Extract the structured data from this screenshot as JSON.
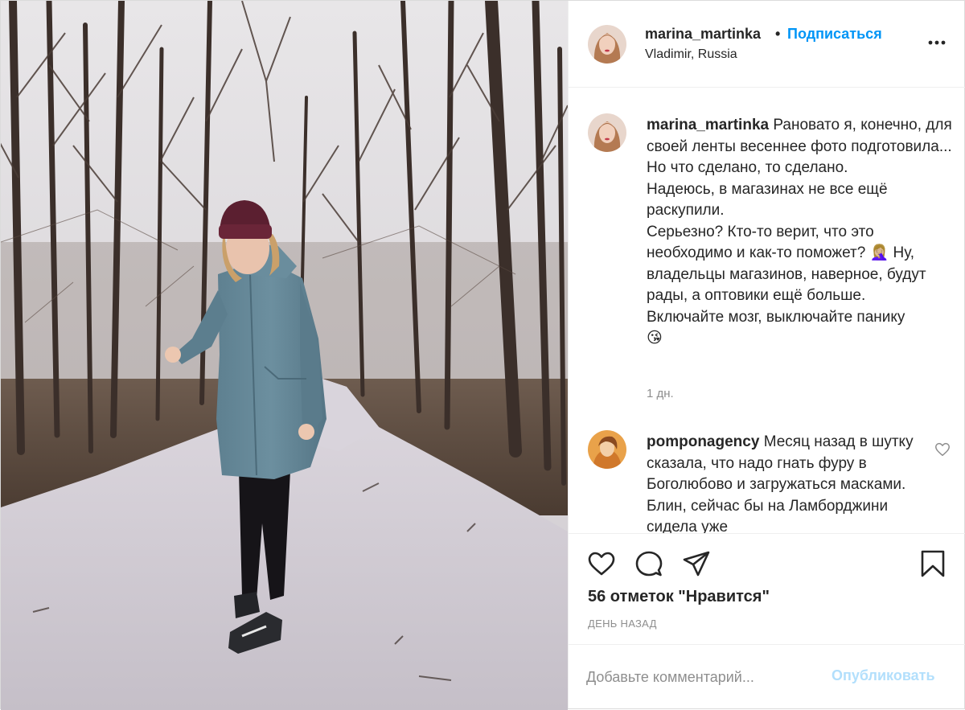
{
  "header": {
    "username": "marina_martinka",
    "separator": "•",
    "follow_label": "Подписаться",
    "location": "Vladimir, Russia",
    "more_icon": "more-horizontal-icon"
  },
  "caption": {
    "username": "marina_martinka",
    "text": "Рановато я, конечно, для своей ленты весеннее фото подготовила...\nНо что сделано, то сделано.\nНадеюсь, в магазинах не все ещё раскупили.\nСерьезно? Кто-то верит, что это необходимо и как-то поможет? 🤦🏼‍♀️ Ну, владельцы магазинов, наверное, будут рады, а оптовики ещё больше.\nВключайте мозг, выключайте панику\n😘",
    "time": "1 дн."
  },
  "comments": [
    {
      "username": "pomponagency",
      "text": "Месяц назад в шутку сказала, что надо гнать фуру в Боголюбово и загружаться масками. Блин, сейчас бы на Ламборджини сидела уже"
    }
  ],
  "actions": {
    "like_icon": "heart-icon",
    "comment_icon": "comment-icon",
    "share_icon": "paper-plane-icon",
    "save_icon": "bookmark-icon"
  },
  "likes_text": "56 отметок \"Нравится\"",
  "date_text": "ДЕНЬ НАЗАД",
  "add_comment": {
    "placeholder": "Добавьте комментарий...",
    "publish_label": "Опубликовать"
  },
  "colors": {
    "link_blue": "#0095f6",
    "publish_disabled": "#b2dffc",
    "muted_text": "#8e8e8e",
    "text": "#262626"
  }
}
